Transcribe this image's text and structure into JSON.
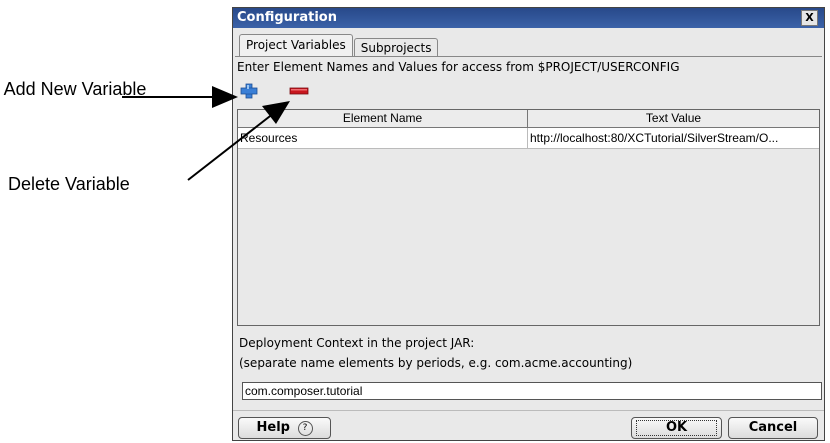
{
  "callouts": {
    "add_new_variable": "Add New Variable",
    "delete_variable": "Delete Variable"
  },
  "dialog": {
    "title": "Configuration",
    "close_symbol": "X",
    "tabs": [
      {
        "label": "Project Variables",
        "active": true
      },
      {
        "label": "Subprojects",
        "active": false
      }
    ],
    "instruction": "Enter Element Names and Values for access from $PROJECT/USERCONFIG",
    "toolbar": {
      "add_icon": "add-plus-icon",
      "delete_icon": "delete-minus-icon"
    },
    "table": {
      "columns": [
        "Element Name",
        "Text Value"
      ],
      "rows": [
        {
          "name": "Resources",
          "value": "http://localhost:80/XCTutorial/SilverStream/O..."
        }
      ]
    },
    "context": {
      "label_line1": "Deployment Context in the project JAR:",
      "label_line2": "(separate name elements by periods, e.g. com.acme.accounting)",
      "value": "com.composer.tutorial"
    },
    "buttons": {
      "help": "Help",
      "help_symbol": "?",
      "ok": "OK",
      "cancel": "Cancel"
    }
  },
  "colors": {
    "titlebar": "#3b62a8",
    "add_icon": "#3a7fd6",
    "delete_icon": "#c8161e"
  }
}
